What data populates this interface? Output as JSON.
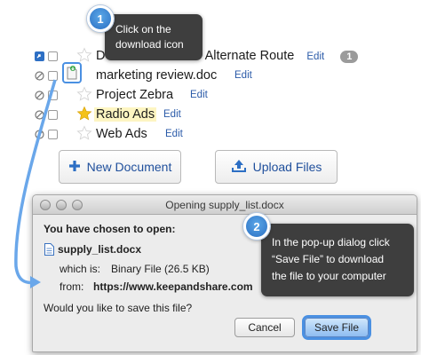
{
  "documents": [
    {
      "name": "D",
      "suffix": "- Alternate Route",
      "edit": "Edit",
      "badge": "1",
      "icon": "shared-icon",
      "starred": false
    },
    {
      "name": "marketing review.doc",
      "edit": "Edit",
      "icon": "no-share-icon",
      "starred": false
    },
    {
      "name": "Project Zebra",
      "edit": "Edit",
      "icon": "no-share-icon",
      "starred": false
    },
    {
      "name": "Radio Ads",
      "edit": "Edit",
      "icon": "no-share-icon",
      "starred": true
    },
    {
      "name": "Web Ads",
      "edit": "Edit",
      "icon": "no-share-icon",
      "starred": false
    }
  ],
  "buttons": {
    "new_document": "New Document",
    "upload_files": "Upload Files"
  },
  "dialog": {
    "title": "Opening supply_list.docx",
    "chosen_label": "You have chosen to open:",
    "filename": "supply_list.docx",
    "which_is_label": "which is:",
    "which_is_value": "Binary File (26.5 KB)",
    "from_label": "from:",
    "from_value": "https://www.keepandshare.com",
    "question": "Would you like to save this file?",
    "cancel": "Cancel",
    "save": "Save File"
  },
  "callouts": {
    "step1_number": "1",
    "step1_line1": "Click on the",
    "step1_line2": "download icon",
    "step2_number": "2",
    "step2_line1": "In the pop-up dialog click",
    "step2_line2": "“Save File” to download",
    "step2_line3": "the file to your computer"
  },
  "colors": {
    "link": "#2a5aa8",
    "callout_bg": "#3e3e3e",
    "step_blue": "#2b6fc2",
    "highlight_ring": "#4a90e2"
  }
}
